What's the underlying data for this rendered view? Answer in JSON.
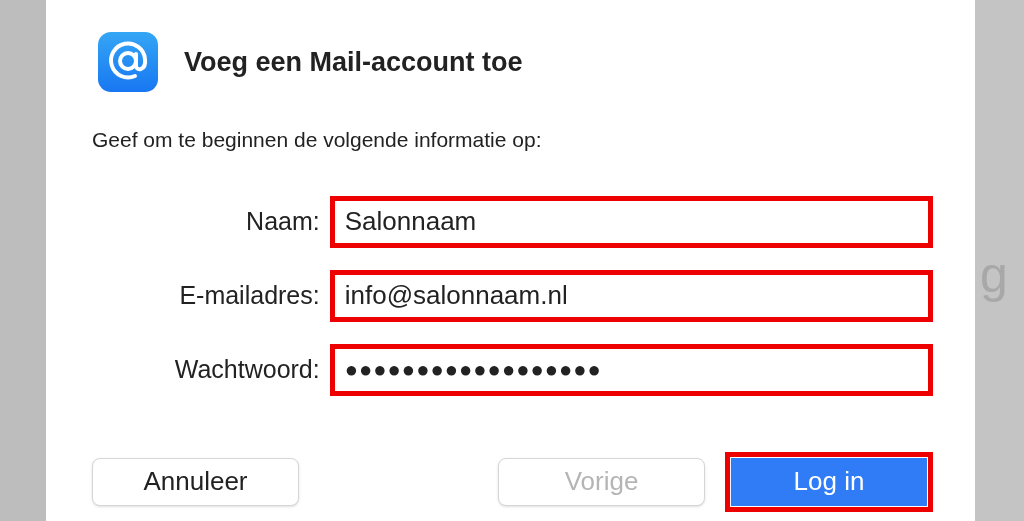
{
  "background_text": "g",
  "dialog": {
    "title": "Voeg een Mail-account toe",
    "instruction": "Geef om te beginnen de volgende informatie op:"
  },
  "fields": [
    {
      "label": "Naam:",
      "value": "Salonnaam",
      "kind": "text",
      "highlighted": true
    },
    {
      "label": "E-mailadres:",
      "value": "info@salonnaam.nl",
      "kind": "text",
      "highlighted": true
    },
    {
      "label": "Wachtwoord:",
      "value": "●●●●●●●●●●●●●●●●●●",
      "kind": "password",
      "highlighted": true
    }
  ],
  "buttons": [
    {
      "label": "Annuleer",
      "kind": "secondary",
      "disabled": false,
      "highlighted": false
    },
    {
      "label": "Vorige",
      "kind": "secondary",
      "disabled": true,
      "highlighted": false
    },
    {
      "label": "Log in",
      "kind": "primary",
      "disabled": false,
      "highlighted": true
    }
  ]
}
